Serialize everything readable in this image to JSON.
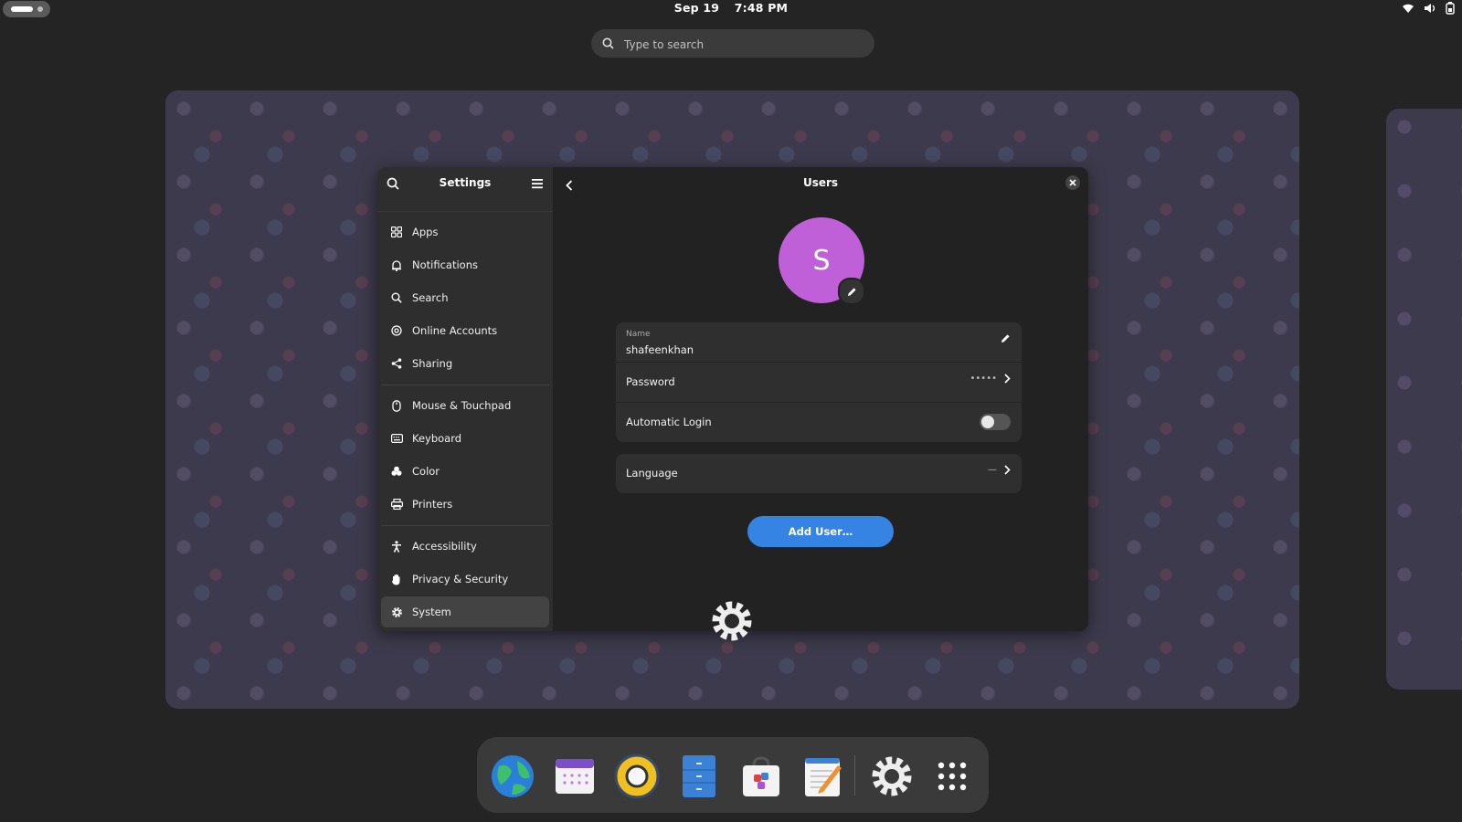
{
  "topbar": {
    "date": "Sep 19",
    "time": "7:48 PM",
    "tray_icons": [
      "wifi-icon",
      "volume-icon",
      "battery-icon"
    ]
  },
  "search": {
    "placeholder": "Type to search"
  },
  "settings": {
    "sidebar_title": "Settings",
    "items": [
      {
        "label": "Apps",
        "icon": "apps-icon"
      },
      {
        "label": "Notifications",
        "icon": "bell-icon"
      },
      {
        "label": "Search",
        "icon": "search-icon"
      },
      {
        "label": "Online Accounts",
        "icon": "at-icon"
      },
      {
        "label": "Sharing",
        "icon": "share-icon"
      },
      {
        "label": "Mouse & Touchpad",
        "icon": "mouse-icon"
      },
      {
        "label": "Keyboard",
        "icon": "keyboard-icon"
      },
      {
        "label": "Color",
        "icon": "color-icon"
      },
      {
        "label": "Printers",
        "icon": "printer-icon"
      },
      {
        "label": "Accessibility",
        "icon": "accessibility-icon"
      },
      {
        "label": "Privacy & Security",
        "icon": "hand-icon"
      },
      {
        "label": "System",
        "icon": "gear-icon"
      }
    ],
    "active_item": "System"
  },
  "users": {
    "title": "Users",
    "avatar_letter": "S",
    "avatar_color": "#c060d8",
    "name_caption": "Name",
    "name_value": "shafeenkhan",
    "password_label": "Password",
    "password_value": "•••••",
    "autologin_label": "Automatic Login",
    "autologin_on": false,
    "language_label": "Language",
    "language_value": "—",
    "add_user_label": "Add User…"
  },
  "dock": {
    "apps": [
      "web-browser-icon",
      "calendar-icon",
      "rhythmbox-icon",
      "files-icon",
      "software-icon",
      "text-editor-icon",
      "settings-icon",
      "app-grid-icon"
    ]
  },
  "colors": {
    "accent": "#3584e4",
    "window_bg": "#222222",
    "sidebar_bg": "#2e2e2e"
  }
}
